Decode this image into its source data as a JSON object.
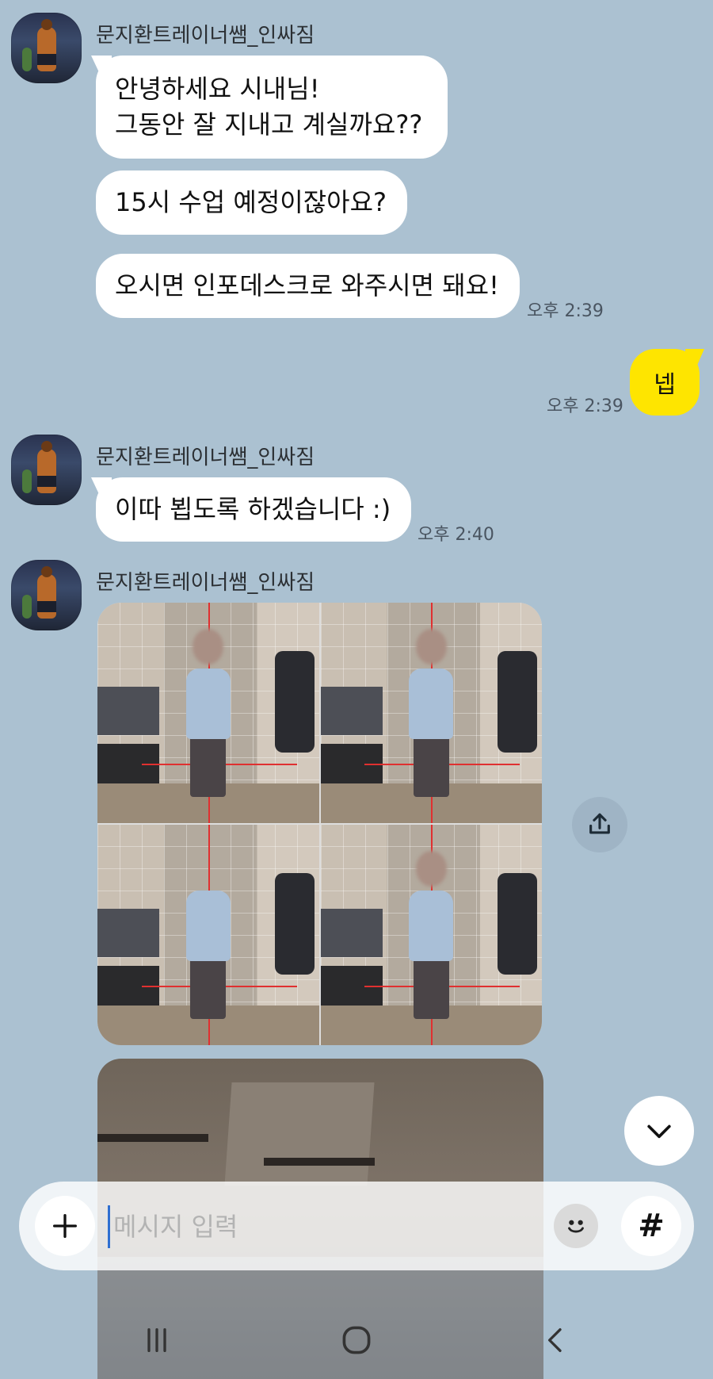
{
  "chat": {
    "sender_name": "문지환트레이너쌤_인싸짐",
    "messages": [
      {
        "line1": "안녕하세요 시내님!",
        "line2": "그동안 잘 지내고 계실까요??"
      },
      {
        "text": "15시 수업 예정이잖아요?"
      },
      {
        "text": "오시면 인포데스크로 와주시면 돼요!",
        "time": "오후 2:39"
      }
    ],
    "my_message": {
      "text": "넵",
      "time": "오후 2:39"
    },
    "message2": {
      "text": "이따 뵙도록 하겠습니다 :)",
      "time": "오후 2:40"
    }
  },
  "composer": {
    "placeholder": "메시지 입력",
    "hash_label": "#"
  },
  "colors": {
    "background": "#abc1d1",
    "my_bubble": "#fee500",
    "other_bubble": "#ffffff"
  },
  "icons": [
    "plus-icon",
    "emoji-icon",
    "hash-icon",
    "share-icon",
    "chevron-down-icon",
    "recent-apps-icon",
    "home-icon",
    "back-icon"
  ]
}
